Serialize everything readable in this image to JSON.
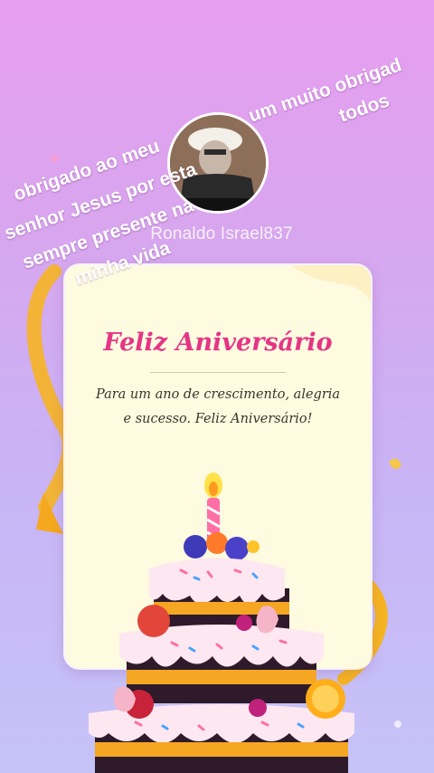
{
  "profile": {
    "username": "Ronaldo Israel837"
  },
  "overlay": {
    "left_lines": [
      "obrigado ao meu",
      "senhor Jesus por esta",
      "sempre presente na",
      "minha vida"
    ],
    "right_lines": [
      "um muito obrigad",
      "todos"
    ]
  },
  "card": {
    "title": "Feliz Aniversário",
    "message": "Para um ano de crescimento, alegria e sucesso. Feliz Aniversário!"
  },
  "colors": {
    "title": "#e53585",
    "card_bg": "#fffbe1",
    "ribbon": "#f6b422"
  }
}
